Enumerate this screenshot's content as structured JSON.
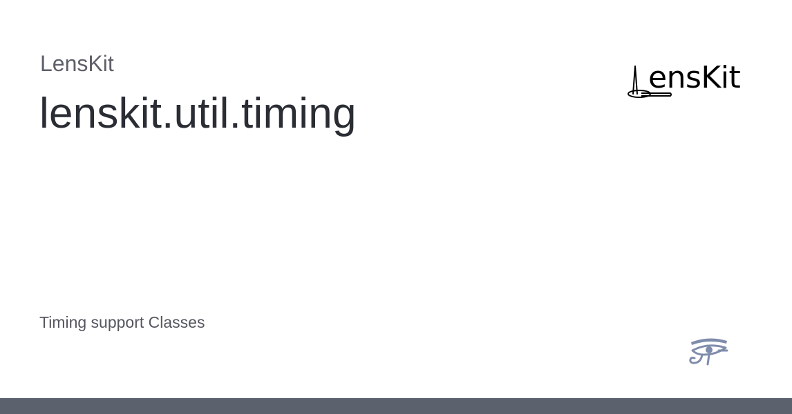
{
  "header": {
    "site_name": "LensKit",
    "page_title": "lenskit.util.timing"
  },
  "main": {
    "description": "Timing support Classes"
  },
  "logo": {
    "wordmark": "LensKit",
    "letters": "ensKit",
    "icon": "lenskit-wordmark-logo"
  },
  "badge": {
    "icon": "eye-of-horus-icon",
    "color": "#7f8cab"
  },
  "colors": {
    "title": "#2a2d33",
    "subtitle": "#5e6069",
    "footer": "#5c626d"
  }
}
